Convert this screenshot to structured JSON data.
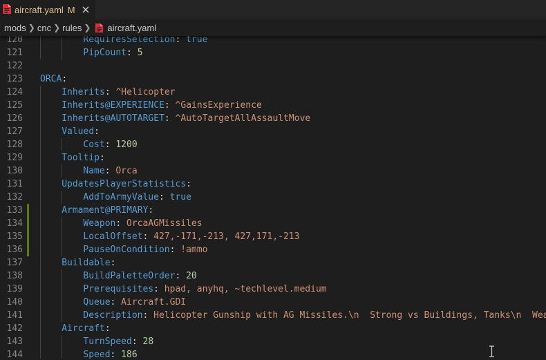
{
  "tab": {
    "label": "aircraft.yaml",
    "badge": "M"
  },
  "breadcrumb": {
    "items": [
      "mods",
      "cnc",
      "rules",
      "aircraft.yaml"
    ]
  },
  "colors": {
    "key": "#569cd6",
    "string": "#ce9178",
    "number": "#b5cea8",
    "modified_gutter": "#587c0c",
    "tab_modified_text": "#e2c08d"
  },
  "editor": {
    "lines": [
      {
        "num": "120",
        "indent": 2,
        "key": "RequiresSelection",
        "value": "true",
        "vtype": "bool"
      },
      {
        "num": "121",
        "indent": 2,
        "key": "PipCount",
        "value": "5",
        "vtype": "num"
      },
      {
        "num": "122",
        "indent": 0,
        "key": "",
        "value": "",
        "vtype": ""
      },
      {
        "num": "123",
        "indent": 0,
        "key": "ORCA",
        "value": "",
        "vtype": ""
      },
      {
        "num": "124",
        "indent": 1,
        "key": "Inherits",
        "value": "^Helicopter",
        "vtype": "str"
      },
      {
        "num": "125",
        "indent": 1,
        "key": "Inherits@EXPERIENCE",
        "value": "^GainsExperience",
        "vtype": "str"
      },
      {
        "num": "126",
        "indent": 1,
        "key": "Inherits@AUTOTARGET",
        "value": "^AutoTargetAllAssaultMove",
        "vtype": "str"
      },
      {
        "num": "127",
        "indent": 1,
        "key": "Valued",
        "value": "",
        "vtype": ""
      },
      {
        "num": "128",
        "indent": 2,
        "key": "Cost",
        "value": "1200",
        "vtype": "num"
      },
      {
        "num": "129",
        "indent": 1,
        "key": "Tooltip",
        "value": "",
        "vtype": ""
      },
      {
        "num": "130",
        "indent": 2,
        "key": "Name",
        "value": "Orca",
        "vtype": "str"
      },
      {
        "num": "131",
        "indent": 1,
        "key": "UpdatesPlayerStatistics",
        "value": "",
        "vtype": ""
      },
      {
        "num": "132",
        "indent": 2,
        "key": "AddToArmyValue",
        "value": "true",
        "vtype": "bool"
      },
      {
        "num": "133",
        "indent": 1,
        "key": "Armament@PRIMARY",
        "value": "",
        "vtype": "",
        "modified": true
      },
      {
        "num": "134",
        "indent": 2,
        "key": "Weapon",
        "value": "OrcaAGMissiles",
        "vtype": "str",
        "modified": true
      },
      {
        "num": "135",
        "indent": 2,
        "key": "LocalOffset",
        "value": "427,-171,-213, 427,171,-213",
        "vtype": "str",
        "modified": true
      },
      {
        "num": "136",
        "indent": 2,
        "key": "PauseOnCondition",
        "value": "!ammo",
        "vtype": "str",
        "modified": true
      },
      {
        "num": "137",
        "indent": 1,
        "key": "Buildable",
        "value": "",
        "vtype": ""
      },
      {
        "num": "138",
        "indent": 2,
        "key": "BuildPaletteOrder",
        "value": "20",
        "vtype": "num"
      },
      {
        "num": "139",
        "indent": 2,
        "key": "Prerequisites",
        "value": "hpad, anyhq, ~techlevel.medium",
        "vtype": "str"
      },
      {
        "num": "140",
        "indent": 2,
        "key": "Queue",
        "value": "Aircraft.GDI",
        "vtype": "str"
      },
      {
        "num": "141",
        "indent": 2,
        "key": "Description",
        "value": "Helicopter Gunship with AG Missiles.\\n  Strong vs Buildings, Tanks\\n  Weak",
        "vtype": "str"
      },
      {
        "num": "142",
        "indent": 1,
        "key": "Aircraft",
        "value": "",
        "vtype": ""
      },
      {
        "num": "143",
        "indent": 2,
        "key": "TurnSpeed",
        "value": "28",
        "vtype": "num"
      },
      {
        "num": "144",
        "indent": 2,
        "key": "Speed",
        "value": "186",
        "vtype": "num"
      }
    ]
  }
}
